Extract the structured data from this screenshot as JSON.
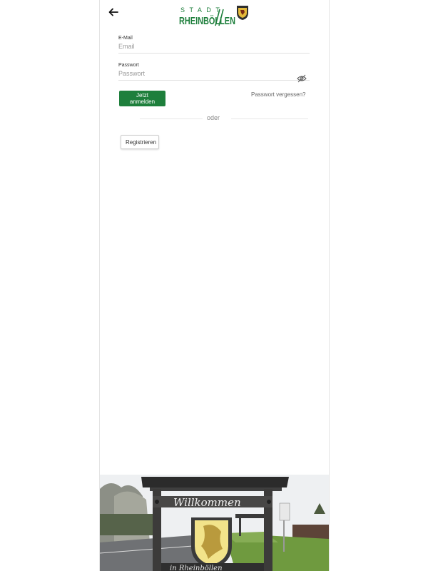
{
  "header": {
    "back_icon": "arrow-left-icon",
    "logo_small": "STADT",
    "logo_main": "RHEINBÖLLEN"
  },
  "form": {
    "email_label": "E-Mail",
    "email_placeholder": "Email",
    "password_label": "Passwort",
    "password_placeholder": "Passwort",
    "eye_icon": "eye-off-icon",
    "login_label": "Jetzt anmelden",
    "forgot_label": "Passwort vergessen?",
    "divider_text": "oder",
    "register_label": "Registrieren"
  },
  "photo": {
    "sign_text": "Willkommen"
  },
  "colors": {
    "accent": "#1e7f3c",
    "logo_green": "#1e7f3c"
  }
}
